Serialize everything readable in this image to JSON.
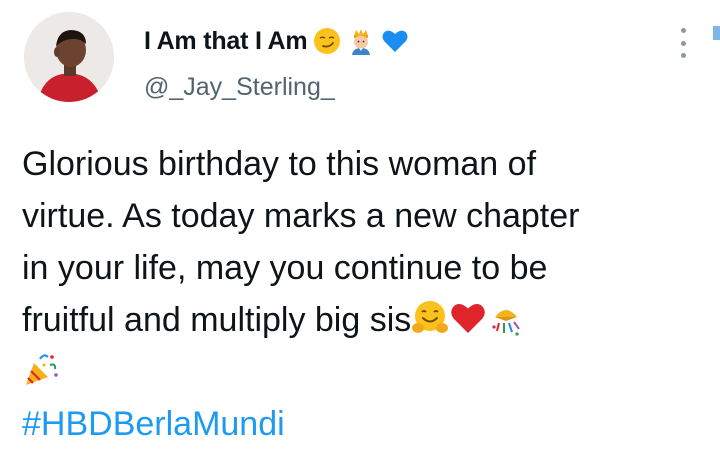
{
  "author": {
    "display_name": "I Am that I Am",
    "handle": "@_Jay_Sterling_",
    "name_emojis": [
      "smirk-face-icon",
      "prince-icon",
      "blue-heart-icon"
    ]
  },
  "tweet": {
    "lines": [
      "Glorious birthday to this woman of",
      "virtue. As today marks a new chapter",
      "in your life, may you continue to be",
      "fruitful and multiply big sis"
    ],
    "hashtag": "#HBDBerlaMundi",
    "trailing_emojis": [
      "hugging-face-icon",
      "red-heart-icon",
      "confetti-ball-icon",
      "party-popper-icon"
    ]
  },
  "colors": {
    "text": "#0f1419",
    "secondary_text": "#536471",
    "link": "#1d9bf0",
    "heart_red": "#e0242b",
    "heart_blue": "#1b8cf0"
  }
}
